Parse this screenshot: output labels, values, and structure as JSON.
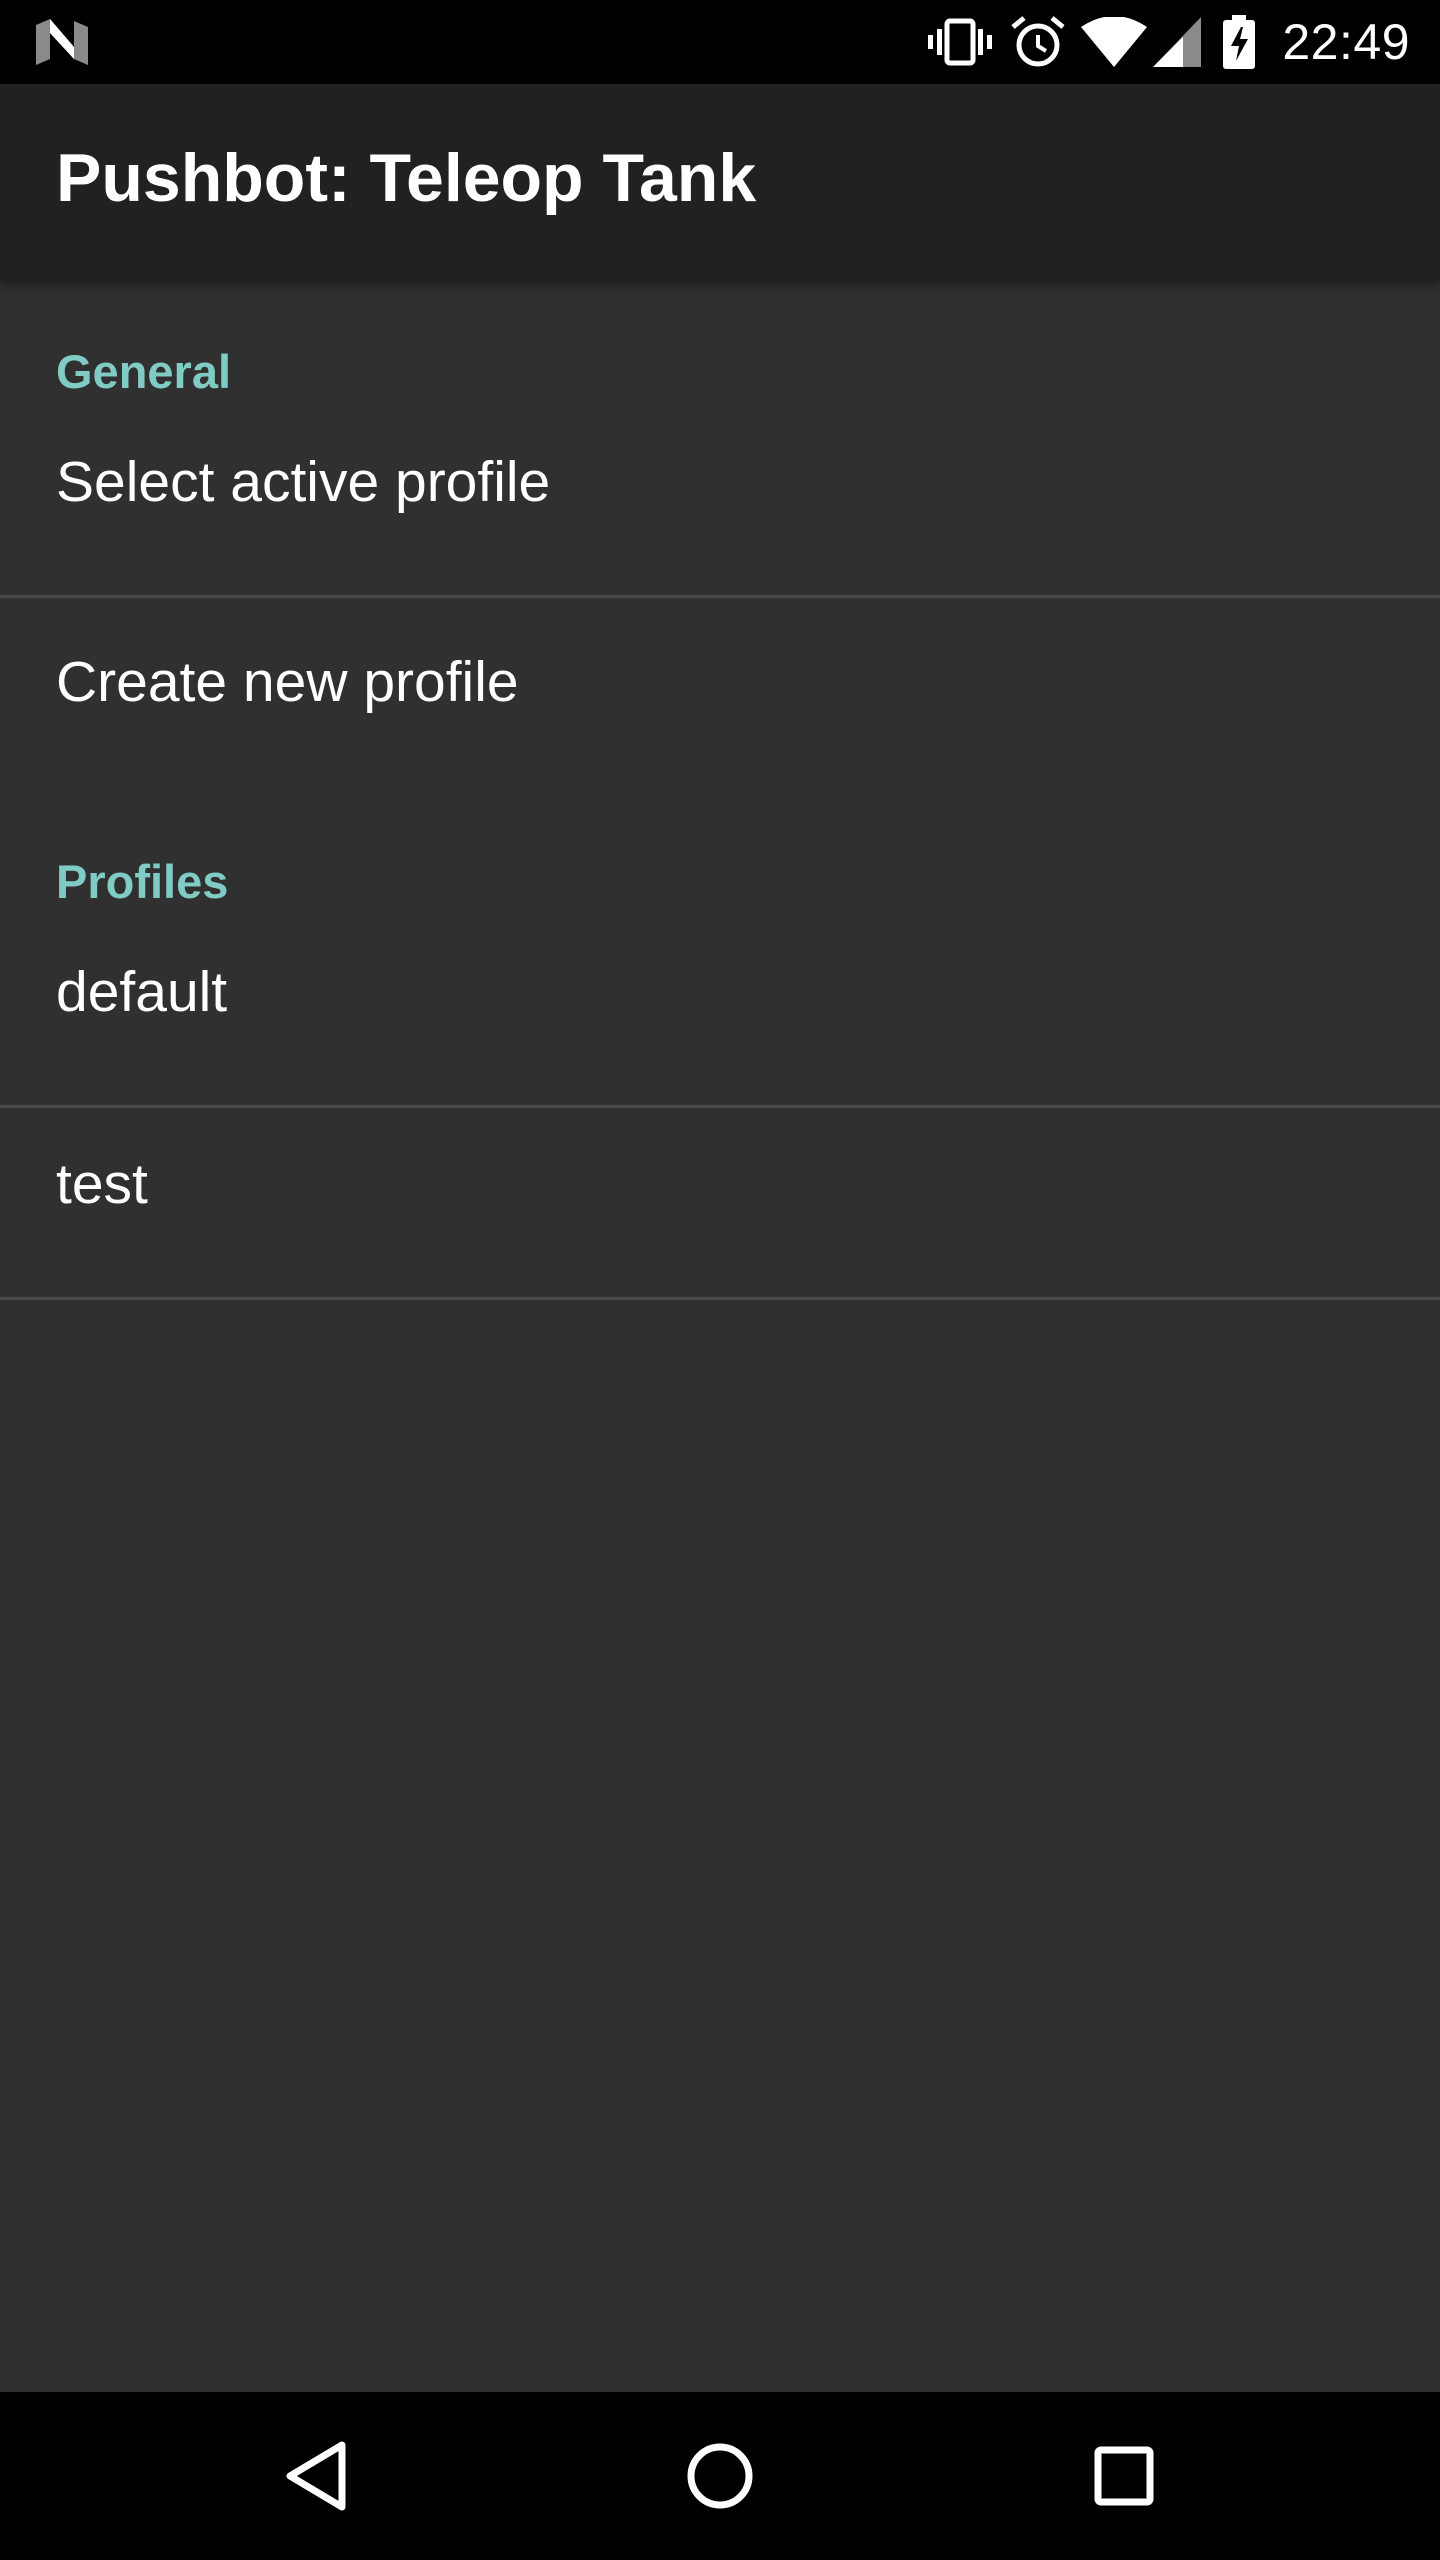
{
  "status_bar": {
    "time": "22:49",
    "icons": [
      "n-logo-icon",
      "vibrate-icon",
      "alarm-icon",
      "wifi-icon",
      "signal-icon",
      "battery-charging-icon"
    ]
  },
  "app_bar": {
    "title": "Pushbot: Teleop Tank"
  },
  "sections": [
    {
      "header": "General",
      "items": [
        "Select active profile",
        "Create new profile"
      ]
    },
    {
      "header": "Profiles",
      "items": [
        "default",
        "test"
      ]
    }
  ],
  "nav_bar": {
    "icons": [
      "back-icon",
      "home-icon",
      "recents-icon"
    ]
  },
  "colors": {
    "background": "#303030",
    "app_bar": "#212121",
    "accent": "#80cbc4",
    "text": "#ffffff"
  }
}
